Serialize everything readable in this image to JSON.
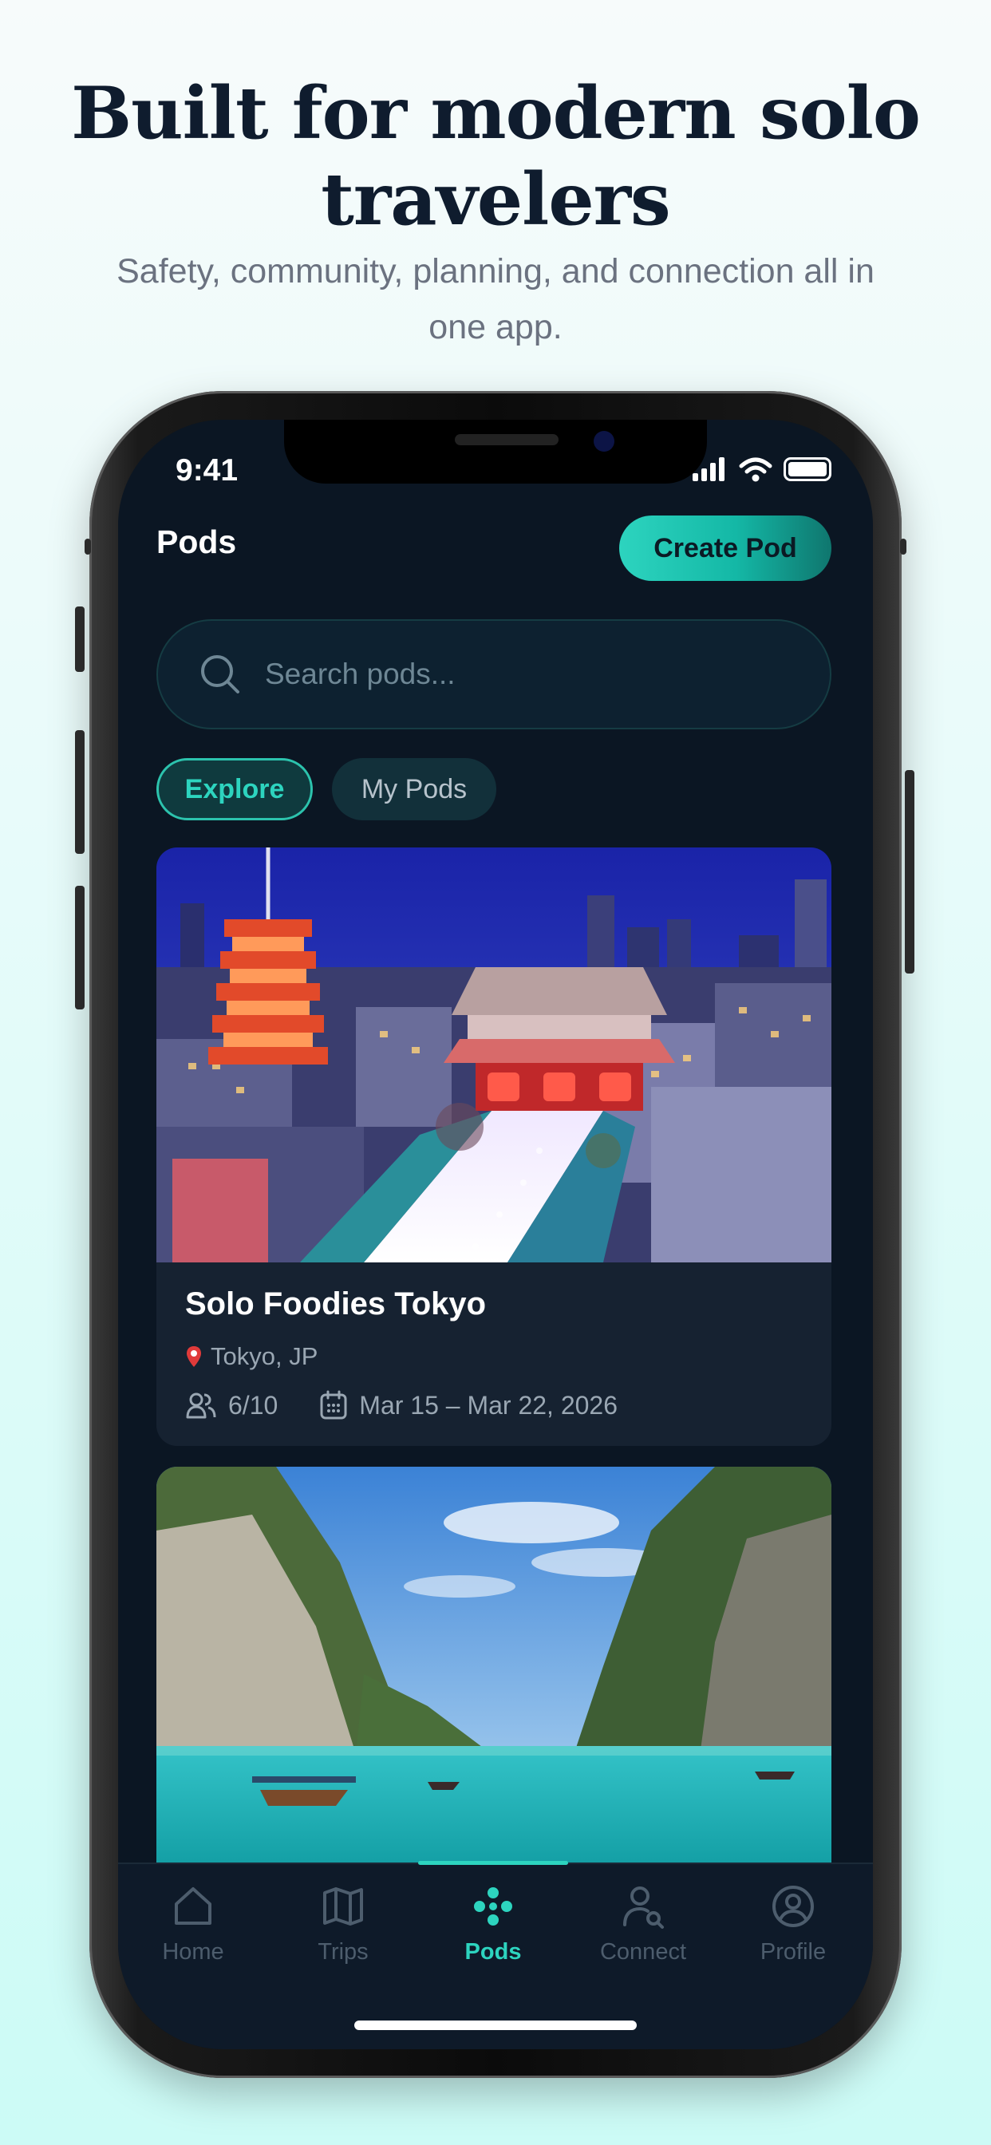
{
  "marketing": {
    "headline": "Built for modern solo travelers",
    "subheadline": "Safety, community, planning, and connection all in one app."
  },
  "status_bar": {
    "time": "9:41"
  },
  "header": {
    "title": "Pods",
    "create_button": "Create Pod"
  },
  "search": {
    "placeholder": "Search pods..."
  },
  "filter_tabs": {
    "explore": "Explore",
    "my_pods": "My Pods",
    "selected": "Explore"
  },
  "pods": [
    {
      "title": "Solo Foodies Tokyo",
      "location": "Tokyo, JP",
      "members": "6/10",
      "dates": "Mar 15 – Mar 22, 2026"
    }
  ],
  "nav": {
    "home": "Home",
    "trips": "Trips",
    "pods": "Pods",
    "connect": "Connect",
    "profile": "Profile",
    "active": "Pods"
  },
  "colors": {
    "accent": "#2dd4bf",
    "screen_bg": "#0b1623",
    "card_bg": "#162231"
  }
}
